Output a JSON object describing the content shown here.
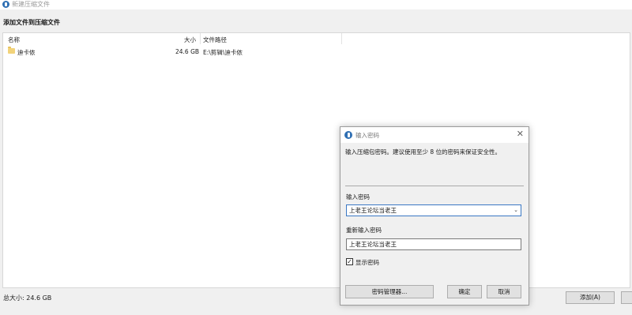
{
  "window": {
    "title": "新建压缩文件"
  },
  "header": {
    "subtitle": "添加文件到压缩文件"
  },
  "file_list": {
    "columns": {
      "name": "名称",
      "size": "大小",
      "path": "文件路径"
    },
    "rows": [
      {
        "name": "迪卡侬",
        "size": "24.6 GB",
        "path": "E:\\剪辑\\迪卡侬",
        "icon": "folder-icon"
      }
    ]
  },
  "status": {
    "total_size": "总大小: 24.6 GB"
  },
  "buttons": {
    "add": "添加(A)"
  },
  "dialog": {
    "title": "输入密码",
    "description": "输入压缩包密码。建议使用至少 8 位的密码来保证安全性。",
    "password_label": "输入密码",
    "password_value": "上老王论坛当老王",
    "confirm_label": "重新输入密码",
    "confirm_value": "上老王论坛当老王",
    "show_password_label": "显示密码",
    "show_password_checked": true,
    "manager_button": "密码管理器...",
    "ok_button": "确定",
    "cancel_button": "取消",
    "accent_color": "#3b78c4"
  }
}
